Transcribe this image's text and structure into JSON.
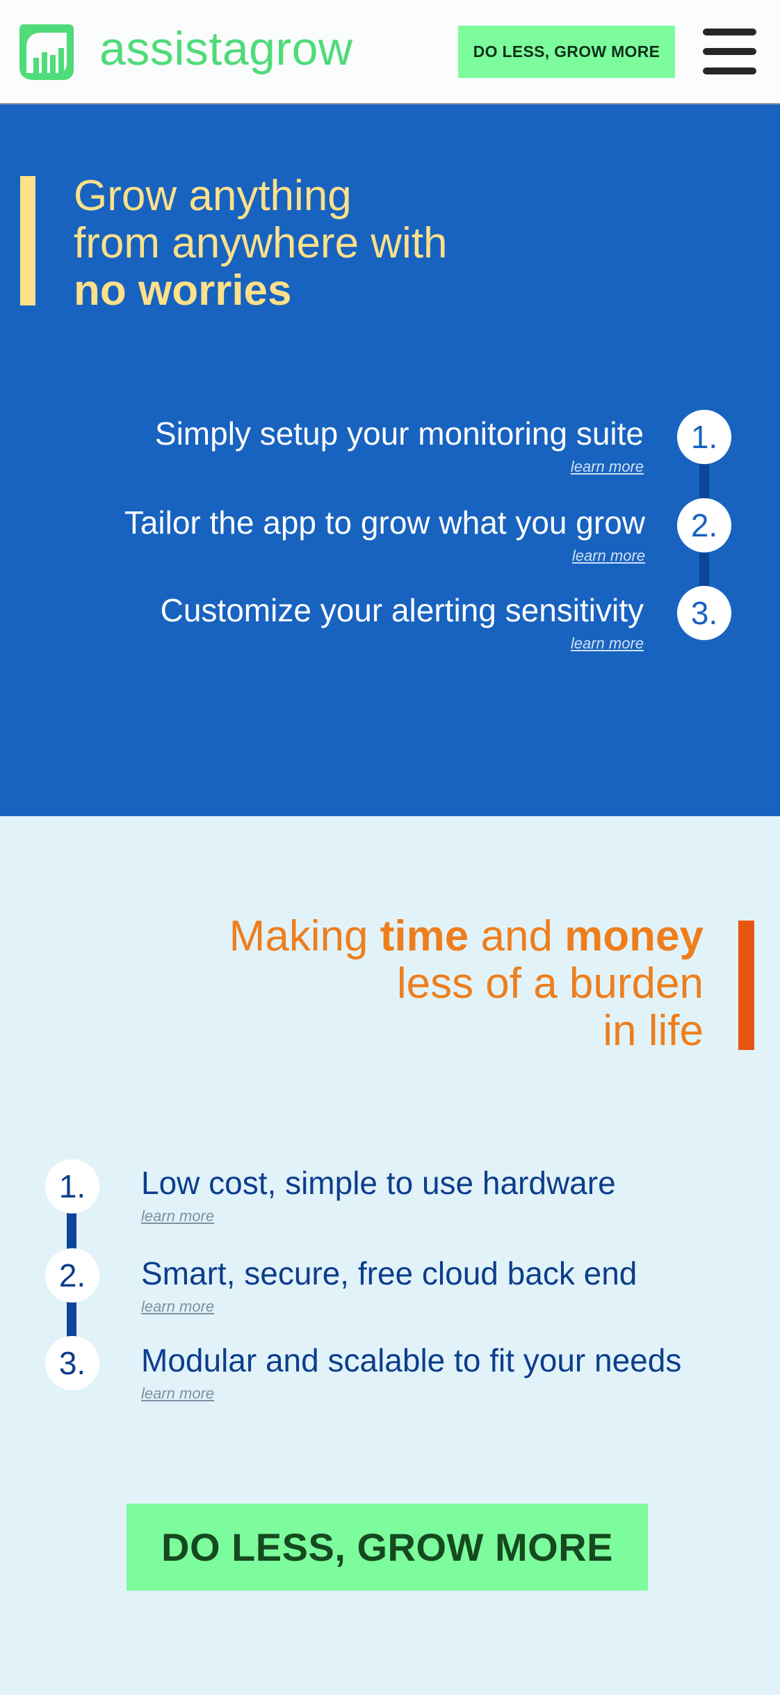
{
  "header": {
    "brand": "assistagrow",
    "cta_label": "DO LESS, GROW MORE"
  },
  "hero": {
    "title_line1": "Grow anything",
    "title_line2": "from anywhere with",
    "title_line3_bold": "no worries",
    "steps": [
      {
        "number": "1.",
        "text": "Simply setup your monitoring suite",
        "link": "learn more"
      },
      {
        "number": "2.",
        "text": "Tailor the app to grow what you grow",
        "link": "learn more"
      },
      {
        "number": "3.",
        "text": "Customize your alerting sensitivity",
        "link": "learn more"
      }
    ]
  },
  "benefits": {
    "title_part1": "Making ",
    "title_bold1": "time",
    "title_part2": " and ",
    "title_bold2": "money",
    "title_line2": "less of a burden",
    "title_line3": "in life",
    "steps": [
      {
        "number": "1.",
        "text": "Low cost, simple to use hardware",
        "link": "learn more"
      },
      {
        "number": "2.",
        "text": "Smart, secure, free cloud back end",
        "link": "learn more"
      },
      {
        "number": "3.",
        "text": "Modular and scalable to fit your needs",
        "link": "learn more"
      }
    ]
  },
  "footer_cta": {
    "label": "DO LESS, GROW MORE"
  },
  "colors": {
    "brand_green": "#4fdb79",
    "cta_green": "#7cfc9c",
    "hero_blue": "#1863bf",
    "hero_yellow": "#fde08a",
    "accent_orange": "#ee7e1c",
    "light_bg": "#e1f3f9"
  }
}
